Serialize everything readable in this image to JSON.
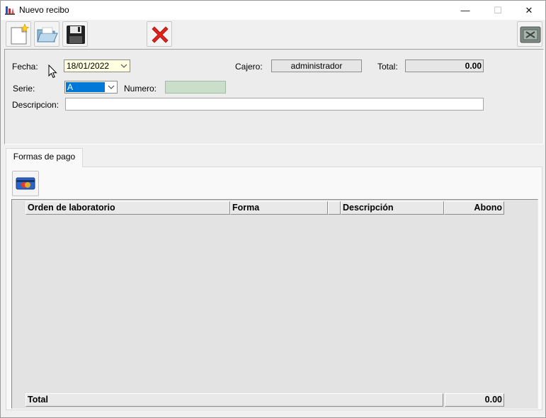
{
  "window": {
    "title": "Nuevo recibo",
    "minimize": "—",
    "maximize": "☐",
    "close": "✕"
  },
  "toolbar": {
    "buttons": [
      {
        "name": "new-document",
        "icon": "new-document-icon"
      },
      {
        "name": "open-folder",
        "icon": "folder-open-icon"
      },
      {
        "name": "save",
        "icon": "floppy-disk-icon"
      },
      {
        "name": "cancel",
        "icon": "red-x-icon"
      },
      {
        "name": "close-window",
        "icon": "exit-icon"
      }
    ]
  },
  "form": {
    "fecha_label": "Fecha:",
    "fecha_value": "18/01/2022",
    "cajero_label": "Cajero:",
    "cajero_value": "administrador",
    "total_label": "Total:",
    "total_value": "0.00",
    "serie_label": "Serie:",
    "serie_value": "A",
    "numero_label": "Numero:",
    "numero_value": "",
    "descripcion_label": "Descripcion:",
    "descripcion_value": ""
  },
  "tabs": [
    {
      "label": "Formas de pago",
      "active": true
    }
  ],
  "grid": {
    "columns": [
      "Orden de laboratorio",
      "Forma",
      "",
      "Descripción",
      "Abono"
    ],
    "rows": [],
    "footer_label": "Total",
    "footer_total": "0.00"
  },
  "colors": {
    "selection": "#0078d7",
    "date_bg": "#ffffe0",
    "numero_bg": "#c9dfc9",
    "cancel_red": "#e0221b"
  }
}
